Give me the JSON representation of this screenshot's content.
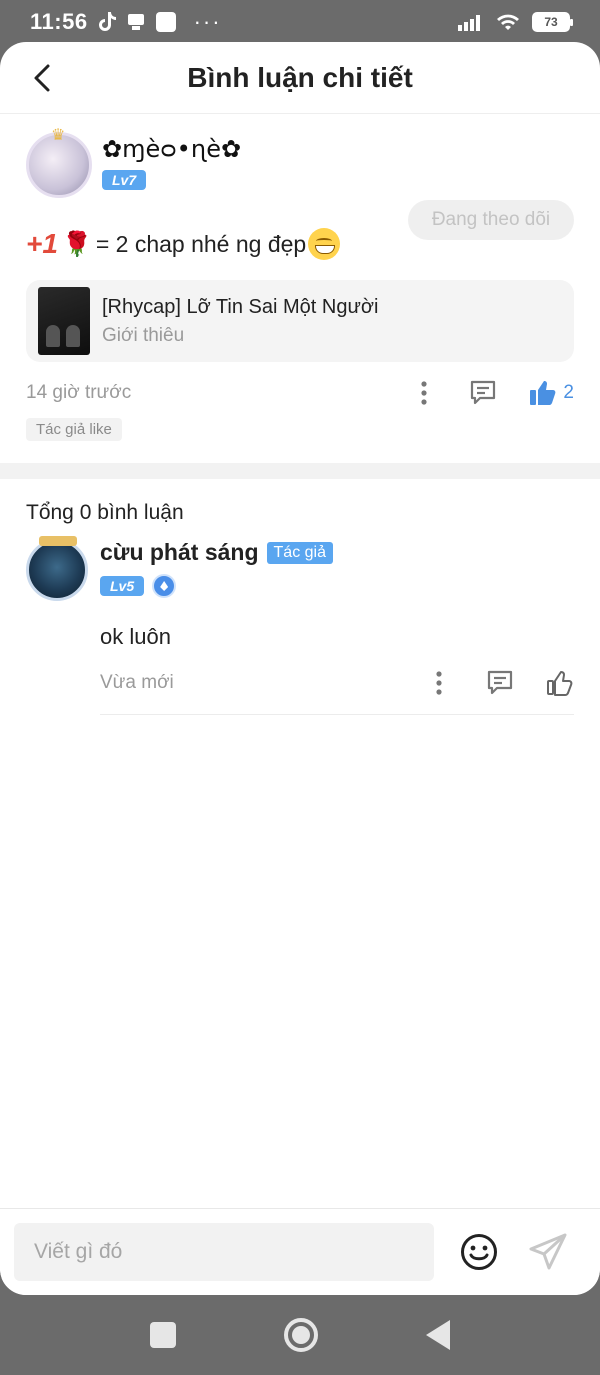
{
  "status_bar": {
    "time": "11:56",
    "battery": "73",
    "dots": "···"
  },
  "header": {
    "title": "Bình luận chi tiết",
    "back_icon": "chevron-left-icon"
  },
  "post": {
    "author_name": "✿ɱèᴑ•ɳè✿",
    "level": "Lv7",
    "follow_label": "Đang theo dõi",
    "text_plus": "+1",
    "text_rose": "🌹",
    "text_body": "= 2 chap nhé ng đẹp",
    "book": {
      "title": "[Rhycap] Lỡ Tin Sai Một Người",
      "subtitle": "Giới thiêu"
    },
    "time": "14 giờ trước",
    "like_count": "2",
    "tag": "Tác giả like"
  },
  "comments_section": {
    "total_label": "Tổng 0 bình luận",
    "items": [
      {
        "name": "cừu phát sáng",
        "author_tag": "Tác giả",
        "level": "Lv5",
        "text": "ok luôn",
        "time": "Vừa mới"
      }
    ]
  },
  "input_bar": {
    "placeholder": "Viết gì đó"
  },
  "colors": {
    "accent": "#5aa6f0",
    "like_active": "#4a90e2",
    "muted": "#9a9a9a"
  }
}
